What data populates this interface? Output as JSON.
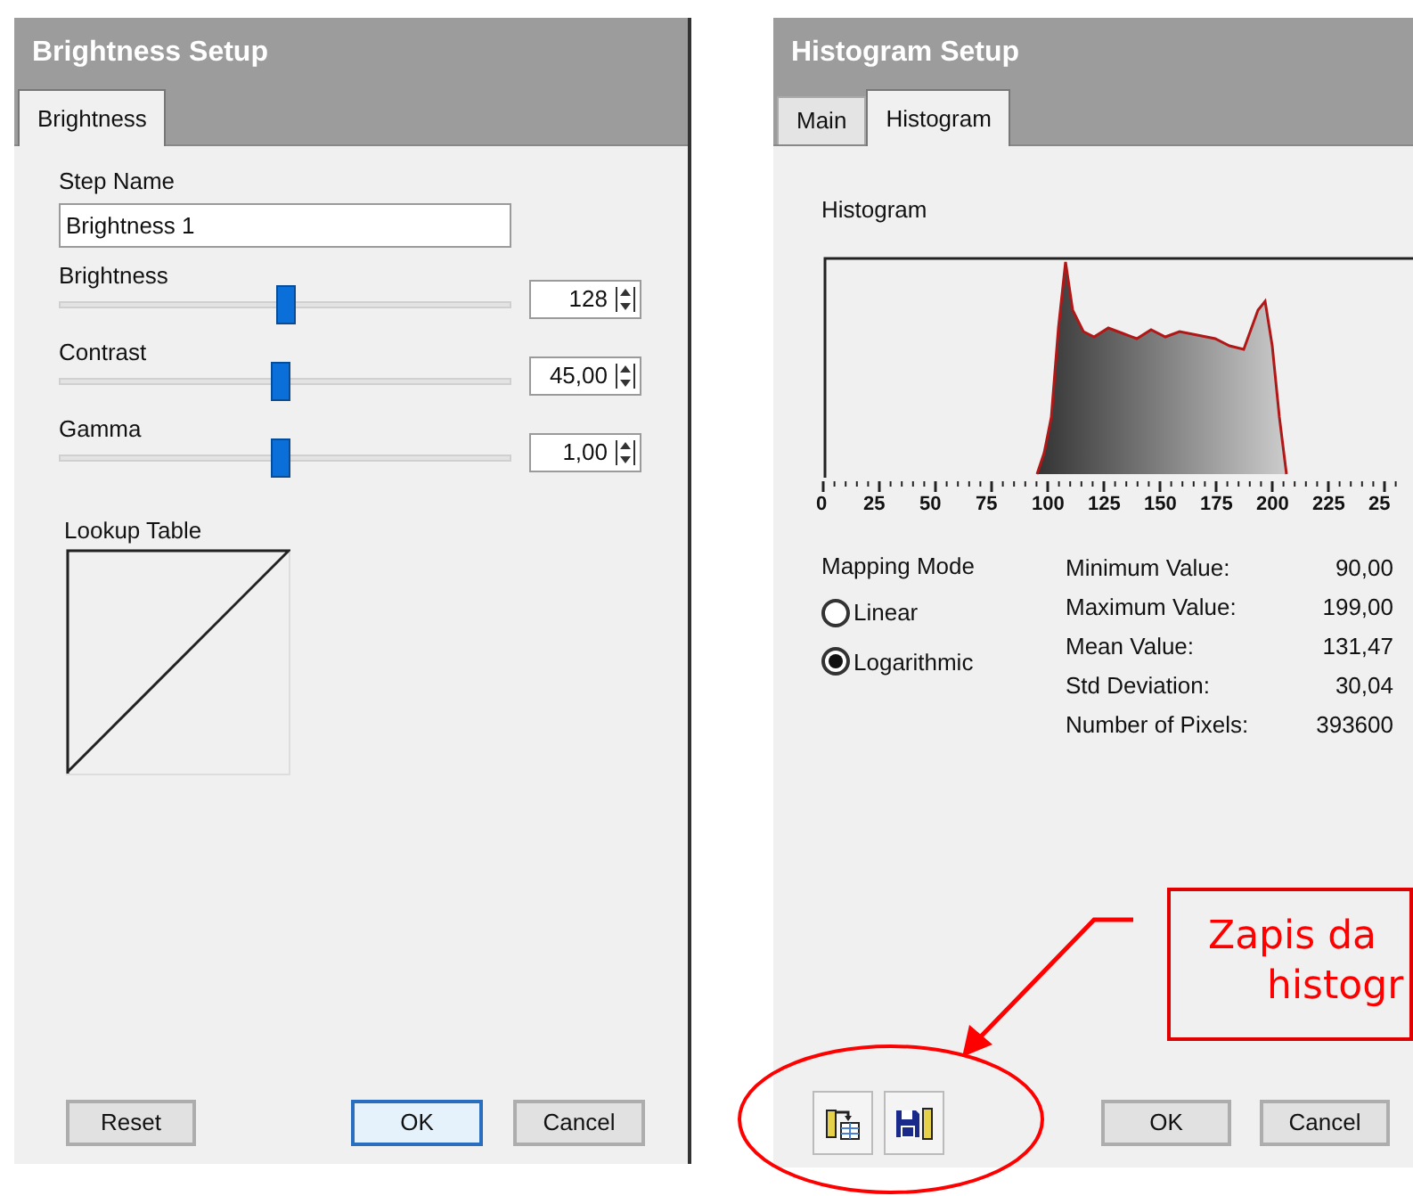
{
  "brightness_dialog": {
    "title": "Brightness Setup",
    "tabs": [
      {
        "label": "Brightness",
        "selected": true
      }
    ],
    "step_name": {
      "label": "Step Name",
      "value": "Brightness 1"
    },
    "sliders": [
      {
        "label": "Brightness",
        "level": 0.5,
        "value": "128"
      },
      {
        "label": "Contrast",
        "level": 0.49,
        "value": "45,00"
      },
      {
        "label": "Gamma",
        "level": 0.49,
        "value": "1,00"
      }
    ],
    "lookup_table": {
      "label": "Lookup Table"
    },
    "buttons": [
      {
        "label": "Reset",
        "default": false
      },
      {
        "label": "OK",
        "default": true
      },
      {
        "label": "Cancel",
        "default": false
      }
    ]
  },
  "histogram_dialog": {
    "title": "Histogram Setup",
    "tabs": [
      {
        "label": "Main",
        "selected": false
      },
      {
        "label": "Histogram",
        "selected": true
      }
    ],
    "histogram": {
      "label": "Histogram",
      "axis_labels": [
        "0",
        "25",
        "50",
        "75",
        "100",
        "125",
        "150",
        "175",
        "200",
        "225",
        "25"
      ]
    },
    "mapping_mode": {
      "label": "Mapping Mode",
      "options": [
        {
          "label": "Linear",
          "selected": false
        },
        {
          "label": "Logarithmic",
          "selected": true
        }
      ]
    },
    "statistics": [
      {
        "label": "Minimum Value:",
        "value": "90,00"
      },
      {
        "label": "Maximum Value:",
        "value": "199,00"
      },
      {
        "label": "Mean Value:",
        "value": "131,47"
      },
      {
        "label": "Std Deviation:",
        "value": "30,04"
      },
      {
        "label": "Number of Pixels:",
        "value": "393600"
      }
    ],
    "buttons": [
      {
        "label": "OK",
        "default": false
      },
      {
        "label": "Cancel",
        "default": false
      }
    ]
  },
  "annotation": {
    "lines": [
      "Zapis da",
      "histogr"
    ]
  }
}
